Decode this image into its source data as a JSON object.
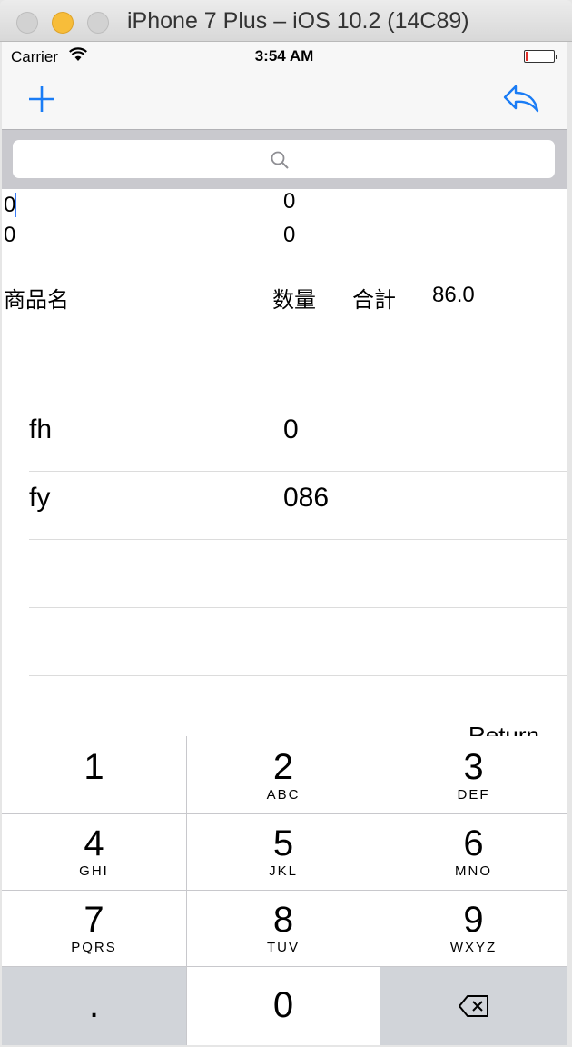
{
  "window": {
    "title": "iPhone 7 Plus – iOS 10.2 (14C89)"
  },
  "status_bar": {
    "carrier": "Carrier",
    "time": "3:54 AM",
    "battery_level": 0.05
  },
  "nav": {
    "add_icon": "plus-icon",
    "back_icon": "reply-arrow-icon"
  },
  "search": {
    "value": "",
    "placeholder": ""
  },
  "counters": [
    {
      "left": "0",
      "right": "0"
    },
    {
      "left": "0",
      "right": "0"
    }
  ],
  "header": {
    "product_name": "商品名",
    "quantity": "数量",
    "total_label": "合計",
    "total_value": "86.0"
  },
  "items": [
    {
      "name": "fh",
      "qty": "0"
    },
    {
      "name": "fy",
      "qty": "086"
    }
  ],
  "keypad": {
    "return_label": "Return",
    "keys": [
      {
        "num": "1",
        "letters": ""
      },
      {
        "num": "2",
        "letters": "ABC"
      },
      {
        "num": "3",
        "letters": "DEF"
      },
      {
        "num": "4",
        "letters": "GHI"
      },
      {
        "num": "5",
        "letters": "JKL"
      },
      {
        "num": "6",
        "letters": "MNO"
      },
      {
        "num": "7",
        "letters": "PQRS"
      },
      {
        "num": "8",
        "letters": "TUV"
      },
      {
        "num": "9",
        "letters": "WXYZ"
      },
      {
        "num": ".",
        "letters": ""
      },
      {
        "num": "0",
        "letters": ""
      }
    ],
    "delete_icon": "backspace-icon"
  }
}
